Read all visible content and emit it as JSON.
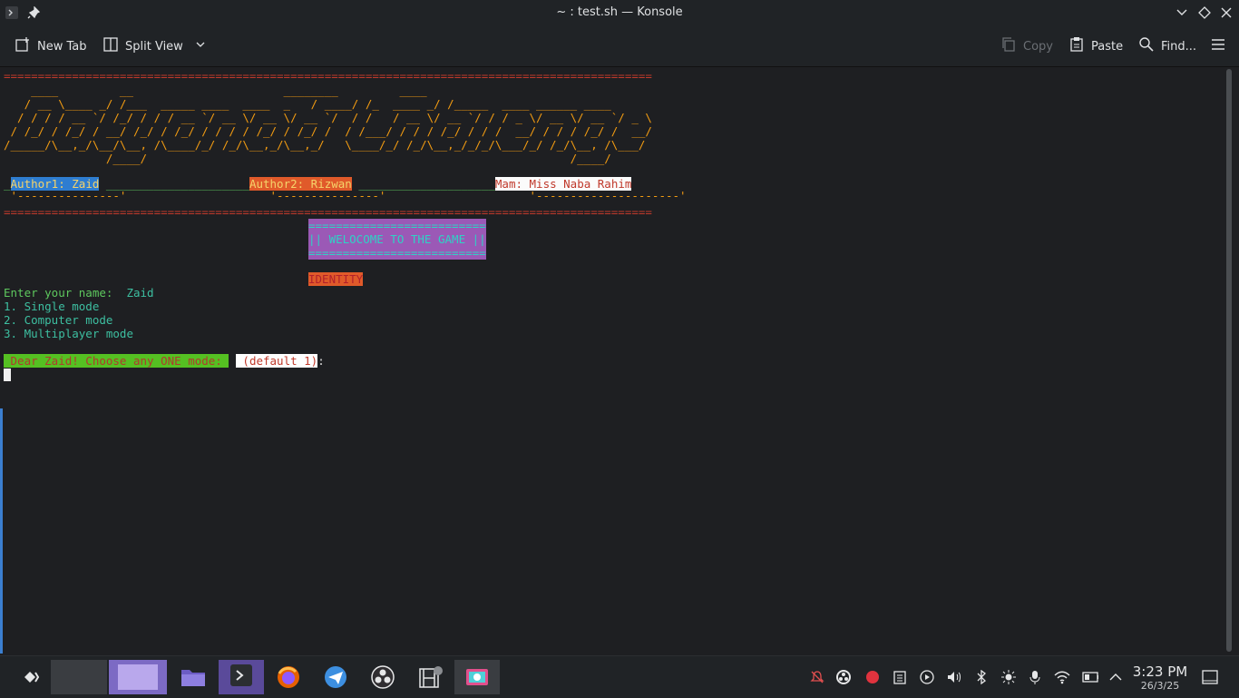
{
  "window": {
    "title": "~ : test.sh — Konsole"
  },
  "toolbar": {
    "new_tab": "New Tab",
    "split_view": "Split View",
    "copy": "Copy",
    "paste": "Paste",
    "find": "Find..."
  },
  "terminal": {
    "separator": "===============================================================================================",
    "ascii_art": [
      "    ____         __                      ________         ____",
      "   / __ \\____ _/ /___  _____ ____  ____  _   / ____/ /_  ____ _/ /_____  ____ ______ ____",
      "  / / / / __ `/ /_/ / / / __ `/ __ \\/ __ \\/ __ `/  / /   / __ \\/ __ `/ / / _ \\/ __ \\/ __ `/ _ \\",
      " / /_/ / /_/ / __/ /_/ / /_/ / / / / /_/ / /_/ /  / /___/ / / / /_/ / / /  __/ / / / /_/ /  __/",
      "/_____/\\__,_/\\__/\\__, /\\____/_/ /_/\\__,_/\\__,_/   \\____/_/ /_/\\__,_/_/_/\\___/_/ /_/\\__, /\\___/",
      "               /____/                                                              /____/"
    ],
    "author1": "Author1: Zaid",
    "author2": "Author2: Rizwan",
    "mam": "Mam: Miss Naba Rahim",
    "welcome_border": "==========================",
    "welcome": "|| WELOCOME TO THE GAME ||",
    "identity": "IDENTITY",
    "enter_name_prompt": "Enter your name:",
    "entered_name": "Zaid",
    "modes": [
      "1. Single mode",
      "2. Computer mode",
      "3. Multiplayer mode"
    ],
    "choose_prompt": " Dear Zaid! Choose any ONE mode: ",
    "default_hint": " (default 1)",
    "colon": ":"
  },
  "clock": {
    "time": "3:23 PM",
    "date": "26/3/25"
  },
  "icons": [
    "terminal-icon",
    "pin-icon",
    "chevron-down-icon",
    "diamond-icon",
    "close-icon",
    "new-tab-icon",
    "split-view-icon",
    "copy-icon",
    "paste-icon",
    "search-icon",
    "menu-icon",
    "app-launcher-icon",
    "files-icon",
    "firefox-icon",
    "plane-app-icon",
    "obs-icon",
    "video-editor-icon",
    "screenshot-icon",
    "notifications-icon",
    "recording-icon",
    "clipboard-icon",
    "media-play-icon",
    "volume-icon",
    "bluetooth-icon",
    "brightness-icon",
    "microphone-icon",
    "wifi-icon",
    "battery-icon",
    "chevron-up-icon",
    "show-desktop-icon"
  ]
}
